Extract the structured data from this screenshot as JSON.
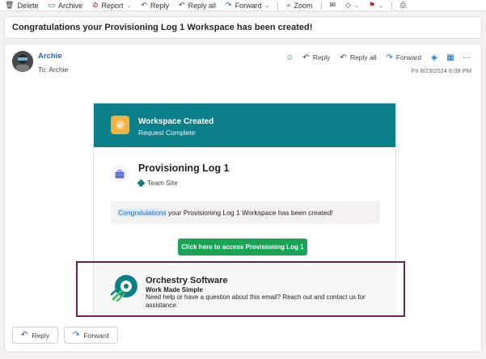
{
  "toolbar": {
    "items": [
      {
        "label": "Delete",
        "icon": "trash-icon"
      },
      {
        "label": "Archive",
        "icon": "archive-icon"
      },
      {
        "label": "Report",
        "icon": "report-icon"
      },
      {
        "label": "Reply",
        "icon": "reply-icon"
      },
      {
        "label": "Reply all",
        "icon": "reply-all-icon"
      },
      {
        "label": "Forward",
        "icon": "forward-icon"
      },
      {
        "label": "Zoom",
        "icon": "zoom-icon"
      }
    ]
  },
  "subject": "Congratulations your Provisioning Log 1 Workspace has been created!",
  "message": {
    "sender": "Archie",
    "to_label": "To:",
    "to_name": "Archie",
    "date": "Fri 8/23/2024 6:08 PM",
    "actions": {
      "reply": "Reply",
      "reply_all": "Reply all",
      "forward": "Forward"
    }
  },
  "card": {
    "header_title": "Workspace Created",
    "header_subtitle": "Request Complete",
    "site_name": "Provisioning Log 1",
    "site_type": "Team Site",
    "notice_highlight": "Congratulations",
    "notice_rest": " your Provisioning Log 1 Workspace has been created!",
    "cta_label": "Click here to access Provisioning Log 1",
    "footer_company": "Orchestry Software",
    "footer_tagline": "Work Made Simple",
    "footer_help": "Need help or have a question about this email? Reach out and contact us for assistance."
  },
  "bottom": {
    "reply": "Reply",
    "forward": "Forward"
  },
  "colors": {
    "header_teal": "#0b7f8a",
    "badge_gold": "#f2b33d",
    "cta_green": "#1aa354",
    "frame_plum": "#6e1e5a",
    "link_blue": "#0f6cbd",
    "reply_purple": "#5c2e91"
  }
}
